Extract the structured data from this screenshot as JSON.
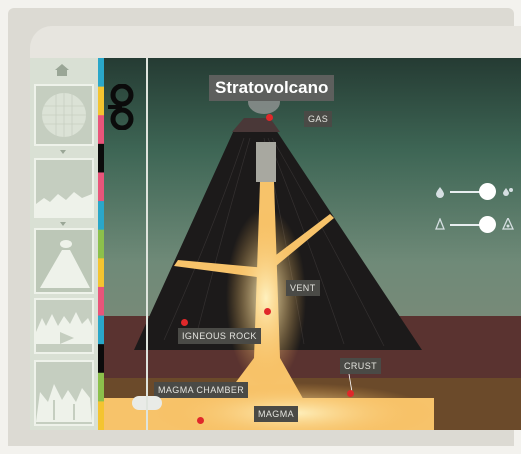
{
  "title": "Stratovolcano",
  "labels": {
    "gas": "GAS",
    "vent": "VENT",
    "igneous_rock": "IGNEOUS ROCK",
    "crust": "CRUST",
    "magma_chamber": "MAGMA CHAMBER",
    "magma": "MAGMA"
  },
  "sidebar": {
    "items": [
      "planet-view",
      "terrain-view",
      "volcano-view",
      "mountain-range-view",
      "rock-formation-view"
    ]
  },
  "sliders": [
    {
      "name": "water-slider",
      "value": 0.75
    },
    {
      "name": "heat-slider",
      "value": 0.8
    }
  ],
  "colors": {
    "magma": "#f7c36a",
    "marker": "#e0282a",
    "strip": [
      "#2aa7c9",
      "#f4c430",
      "#e8557a",
      "#0b0b0b",
      "#e8557a",
      "#2aa7c9",
      "#8cc04b",
      "#f4c430",
      "#e8557a",
      "#2aa7c9",
      "#0b0b0b",
      "#8cc04b",
      "#f4c430"
    ]
  }
}
